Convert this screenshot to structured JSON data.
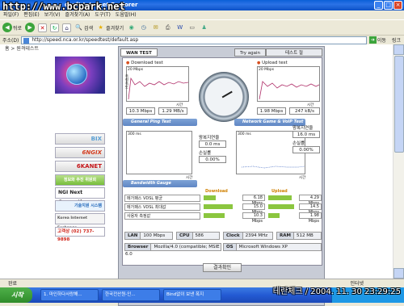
{
  "window": {
    "title": "osoft Internet Explorer",
    "watermark": "http://www.bcpark.net"
  },
  "menu": [
    "파일(F)",
    "편집(E)",
    "보기(V)",
    "즐겨찾기(A)",
    "도구(T)",
    "도움말(H)"
  ],
  "toolbar": {
    "back": "뒤로",
    "search": "검색",
    "favorites": "즐겨찾기"
  },
  "address": {
    "label": "주소(D)",
    "url": "http://speed.nca.or.kr/speedtest/default.asp",
    "go": "이동",
    "links": "링크"
  },
  "page": {
    "breadcrumb": "홈 > 원격테스트",
    "nav": [
      "BIX",
      "6NGIX",
      "6KANET",
      "정보화 추진 위원회",
      "NGI Next Generation",
      "기술지원 시스템",
      "Korea Internet Exchange",
      "고객상 (02) 737-9898"
    ],
    "tabs": {
      "wan": "WAN TEST",
      "again": "Try again",
      "test": "테스트 절"
    },
    "download": {
      "title": "Download test",
      "axis_max": "20 Mbps",
      "y_label": "측정속도",
      "x_label": "시간",
      "mbps": "10.3 Mbps",
      "kbs": "1.29 MB/s"
    },
    "upload": {
      "title": "Upload test",
      "axis_max": "20 Mbps",
      "y_label": "측정속도",
      "x_label": "시간",
      "mbps": "1.98 Mbps",
      "kbs": "247 kB/s"
    },
    "ping": {
      "section": "General Ping Test",
      "axis": "300 ms",
      "x_label": "시간",
      "delay_label": "왕복지연율",
      "delay": "0.0 ms",
      "loss_label": "손실률",
      "loss": "0.00%"
    },
    "voip": {
      "section": "Network Game & VoIP Test",
      "axis": "300 ms",
      "x_label": "시간",
      "delay_label": "왕복지연율",
      "delay": "16.0 ms",
      "loss_label": "손실률",
      "loss": "0.00%"
    },
    "bandwidth": {
      "section": "Bandwidth Gauge",
      "download_header": "Download",
      "upload_header": "Upload",
      "rows": [
        {
          "label": "메가패스 VDSL 평균",
          "dl": "6.18 Mbps",
          "dl_frac": 0.35,
          "ul": "4.29 Mbps",
          "ul_frac": 0.85
        },
        {
          "label": "메가패스 VDSL 최대값",
          "dl": "15.0 Mbps",
          "dl_frac": 0.82,
          "ul": "14.5 Mbps",
          "ul_frac": 0.95
        },
        {
          "label": "사용자 측정값",
          "dl": "10.3 Mbps",
          "dl_frac": 0.58,
          "ul": "1.98 Mbps",
          "ul_frac": 0.42
        }
      ]
    },
    "system": {
      "lan_k": "LAN",
      "lan": "100 Mbps",
      "cpu_k": "CPU",
      "cpu": "586",
      "clock_k": "Clock",
      "clock": "2394 MHz",
      "ram_k": "RAM",
      "ram": "512 MB",
      "browser_k": "Browser",
      "browser": "Mozilla/4.0 (compatible; MSIE 6.0",
      "os_k": "OS",
      "os": "Microsoft Windows XP"
    },
    "result_button": "결과확인"
  },
  "status": {
    "text": "완료",
    "zone": "인터넷"
  },
  "taskbar": {
    "start": "시작",
    "tasks": [
      "1. 마인하다사랑해...",
      "한국전산원-인...",
      "Bind없이 보낸 폭지"
    ]
  },
  "stamp": "테란체크 / 2004. 11. 30 23:29:25"
}
